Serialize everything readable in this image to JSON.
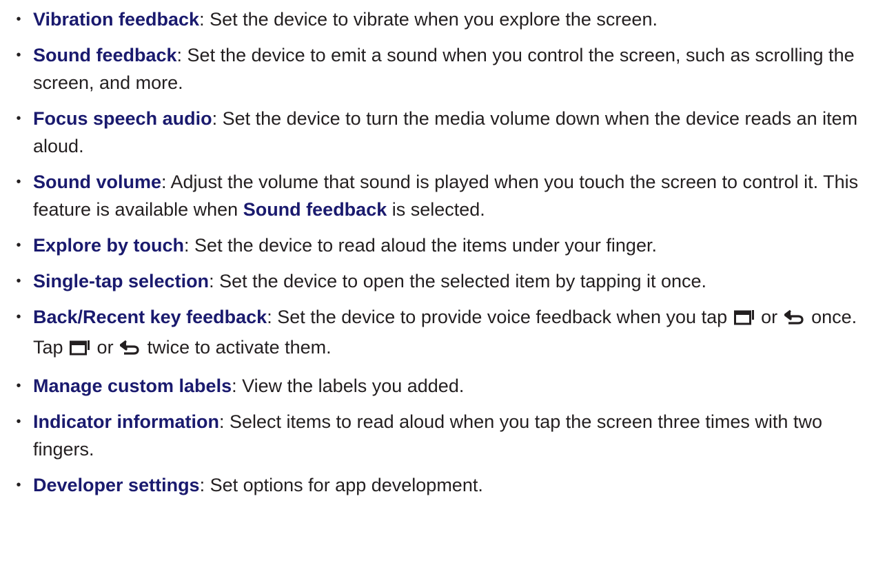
{
  "items": [
    {
      "term": "Vibration feedback",
      "text": ": Set the device to vibrate when you explore the screen."
    },
    {
      "term": "Sound feedback",
      "text": ": Set the device to emit a sound when you control the screen, such as scrolling the screen, and more."
    },
    {
      "term": "Focus speech audio",
      "text": ": Set the device to turn the media volume down when the device reads an item aloud."
    },
    {
      "term": "Sound volume",
      "text": ": Adjust the volume that sound is played when you touch the screen to control it. This feature is available when ",
      "term2": "Sound feedback",
      "text2": " is selected."
    },
    {
      "term": "Explore by touch",
      "text": ": Set the device to read aloud the items under your finger."
    },
    {
      "term": "Single-tap selection",
      "text": ": Set the device to open the selected item by tapping it once."
    },
    {
      "term": "Back/Recent key feedback",
      "parts": [
        ": Set the device to provide voice feedback when you tap ",
        " or ",
        " once. Tap ",
        " or ",
        " twice to activate them."
      ],
      "icons": [
        "recent-apps-icon",
        "back-icon",
        "recent-apps-icon",
        "back-icon"
      ]
    },
    {
      "term": "Manage custom labels",
      "text": ": View the labels you added."
    },
    {
      "term": "Indicator information",
      "text": ": Select items to read aloud when you tap the screen three times with two fingers."
    },
    {
      "term": "Developer settings",
      "text": ": Set options for app development."
    }
  ],
  "bullet": "•"
}
